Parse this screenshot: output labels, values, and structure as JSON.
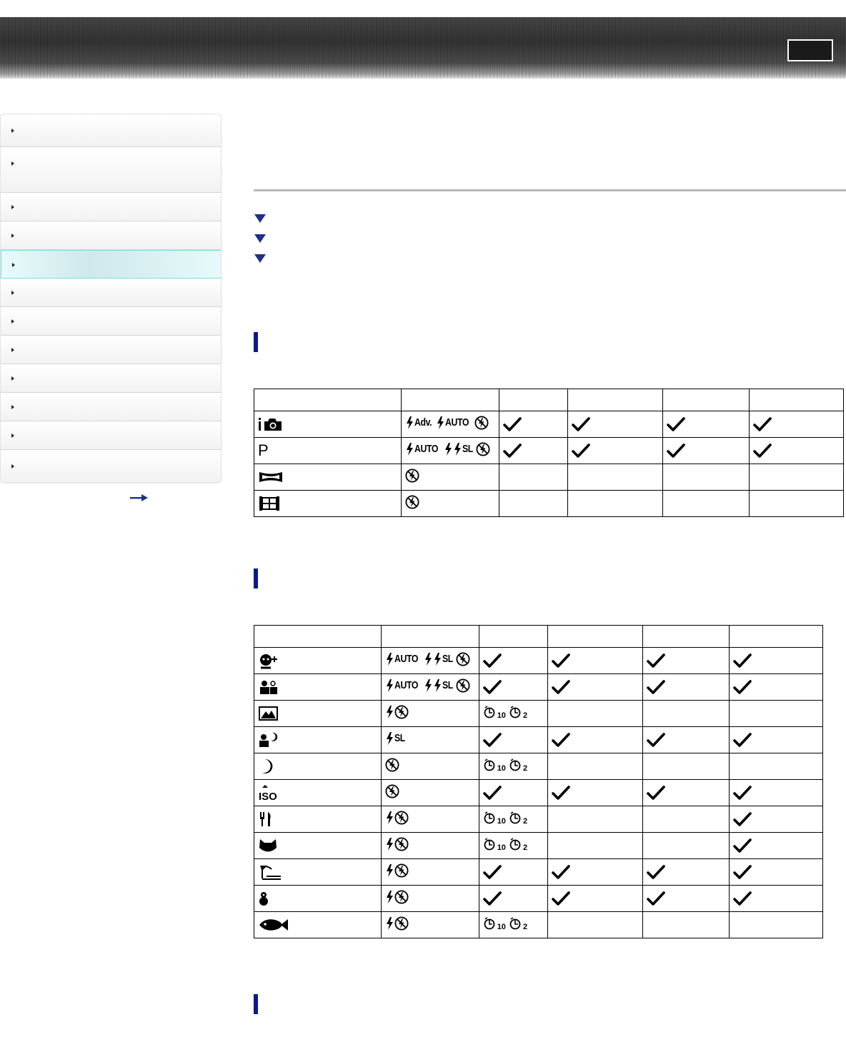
{
  "header": {
    "button_label": ""
  },
  "sidebar": {
    "items": [
      {
        "label": "",
        "active": false
      },
      {
        "label": "",
        "active": false
      },
      {
        "label": "",
        "active": false
      },
      {
        "label": "",
        "active": false
      },
      {
        "label": "",
        "active": true
      },
      {
        "label": "",
        "active": false
      },
      {
        "label": "",
        "active": false
      },
      {
        "label": "",
        "active": false
      },
      {
        "label": "",
        "active": false
      },
      {
        "label": "",
        "active": false
      },
      {
        "label": "",
        "active": false
      },
      {
        "label": "",
        "active": false
      }
    ],
    "more_icon": "right-arrow-icon"
  },
  "jump_links": [
    {
      "icon": "down-triangle-icon",
      "label": ""
    },
    {
      "icon": "down-triangle-icon",
      "label": ""
    },
    {
      "icon": "down-triangle-icon",
      "label": ""
    }
  ],
  "table1": {
    "rows": [
      {
        "mode_icon": "intelligent-auto-icon",
        "flash": [
          "flash-adv",
          "flash-auto",
          "flash-off"
        ],
        "cols": [
          "check",
          "check",
          "check",
          "check"
        ]
      },
      {
        "mode_icon": "program-auto-icon",
        "mode_text": "P",
        "flash": [
          "flash-auto",
          "flash-on",
          "flash-slow-sync",
          "flash-off"
        ],
        "cols": [
          "check",
          "check",
          "check",
          "check"
        ]
      },
      {
        "mode_icon": "sweep-panorama-icon",
        "flash": [
          "flash-off"
        ],
        "cols": [
          "",
          "",
          "",
          ""
        ]
      },
      {
        "mode_icon": "movie-mode-icon",
        "flash": [
          "flash-off"
        ],
        "cols": [
          "",
          "",
          "",
          ""
        ]
      }
    ]
  },
  "table2": {
    "rows": [
      {
        "mode_icon": "soft-skin-icon",
        "flash": [
          "flash-auto",
          "flash-on",
          "flash-slow-sync",
          "flash-off"
        ],
        "cols": [
          "check",
          "check",
          "check",
          "check"
        ]
      },
      {
        "mode_icon": "soft-snap-icon",
        "flash": [
          "flash-auto",
          "flash-on",
          "flash-slow-sync",
          "flash-off"
        ],
        "cols": [
          "check",
          "check",
          "check",
          "check"
        ]
      },
      {
        "mode_icon": "landscape-icon",
        "flash": [
          "flash-on",
          "flash-off"
        ],
        "cols": [
          "timer",
          "",
          "",
          ""
        ]
      },
      {
        "mode_icon": "twilight-portrait-icon",
        "flash": [
          "flash-slow-sync"
        ],
        "cols": [
          "check",
          "check",
          "check",
          "check"
        ]
      },
      {
        "mode_icon": "twilight-icon",
        "flash": [
          "flash-off"
        ],
        "cols": [
          "timer",
          "",
          "",
          ""
        ]
      },
      {
        "mode_icon": "high-sensitivity-icon",
        "flash": [
          "flash-off"
        ],
        "cols": [
          "check",
          "check",
          "check",
          "check"
        ]
      },
      {
        "mode_icon": "gourmet-icon",
        "flash": [
          "flash-on",
          "flash-off"
        ],
        "cols": [
          "timer",
          "",
          "",
          "check"
        ]
      },
      {
        "mode_icon": "pet-icon",
        "flash": [
          "flash-on",
          "flash-off"
        ],
        "cols": [
          "timer",
          "",
          "",
          "check"
        ]
      },
      {
        "mode_icon": "beach-icon",
        "flash": [
          "flash-on",
          "flash-off"
        ],
        "cols": [
          "check",
          "check",
          "check",
          "check"
        ]
      },
      {
        "mode_icon": "snow-icon",
        "flash": [
          "flash-on",
          "flash-off"
        ],
        "cols": [
          "check",
          "check",
          "check",
          "check"
        ]
      },
      {
        "mode_icon": "underwater-icon",
        "flash": [
          "flash-on",
          "flash-off"
        ],
        "cols": [
          "timer",
          "",
          "",
          ""
        ]
      }
    ]
  },
  "flash_text": {
    "adv": "Adv.",
    "auto": "AUTO",
    "sl": "SL"
  },
  "timer_text": {
    "t10": "10",
    "t2": "2"
  }
}
